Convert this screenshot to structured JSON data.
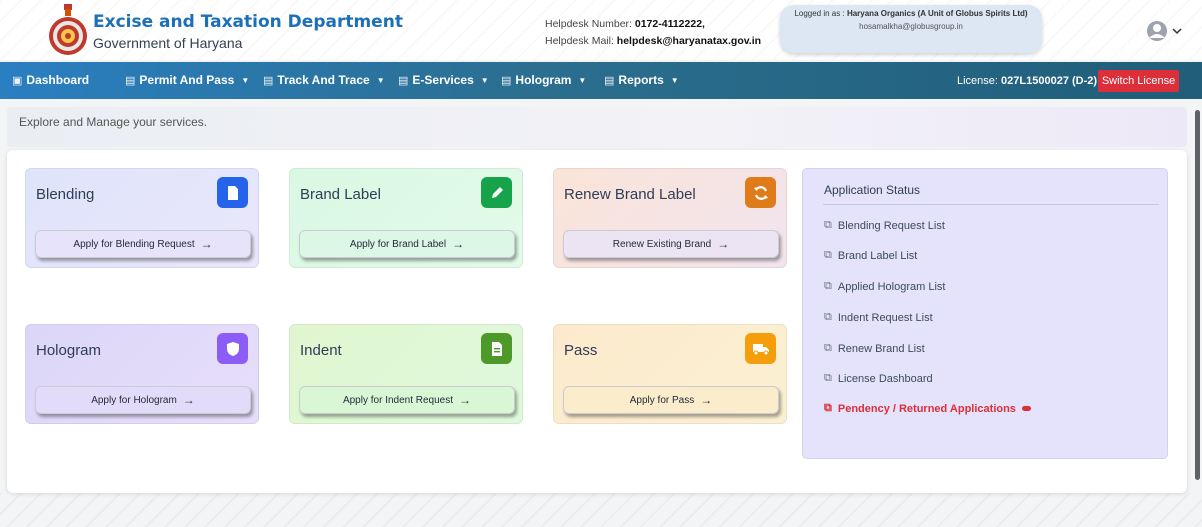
{
  "header": {
    "title": "Excise and Taxation Department",
    "subtitle": "Government of Haryana",
    "helpdesk_number_label": "Helpdesk Number:",
    "helpdesk_number": "0172-4112222,",
    "helpdesk_mail_label": "Helpdesk Mail:",
    "helpdesk_mail": "helpdesk@haryanatax.gov.in",
    "logged_in_label": "Logged in as :",
    "org_name": "Haryana Organics (A Unit of Globus Spirits Ltd)",
    "user_email": "hosamalkha@globusgroup.in"
  },
  "nav": {
    "items": [
      {
        "label": "Dashboard",
        "icon": "dashboard-icon"
      },
      {
        "label": "Permit And Pass",
        "icon": "list-icon"
      },
      {
        "label": "Track And Trace",
        "icon": "list-icon"
      },
      {
        "label": "E-Services",
        "icon": "list-icon"
      },
      {
        "label": "Hologram",
        "icon": "list-icon"
      },
      {
        "label": "Reports",
        "icon": "list-icon"
      }
    ],
    "license_label": "License:",
    "license_value": "027L1500027 (D-2)",
    "switch_label": "Switch License"
  },
  "explore_text": "Explore and Manage your services.",
  "cards": [
    {
      "title": "Blending",
      "button": "Apply for Blending Request",
      "icon": "document-icon",
      "color": "#2563eb"
    },
    {
      "title": "Brand Label",
      "button": "Apply for Brand Label",
      "icon": "pencil-icon",
      "color": "#16a34a"
    },
    {
      "title": "Renew Brand Label",
      "button": "Renew Existing Brand",
      "icon": "refresh-icon",
      "color": "#e07b1a"
    },
    {
      "title": "Hologram",
      "button": "Apply for Hologram",
      "icon": "shield-icon",
      "color": "#8b5cf6"
    },
    {
      "title": "Indent",
      "button": "Apply for Indent Request",
      "icon": "document-icon",
      "color": "#4d9a2a"
    },
    {
      "title": "Pass",
      "button": "Apply for Pass",
      "icon": "truck-icon",
      "color": "#f59e0b"
    }
  ],
  "status": {
    "title": "Application Status",
    "links": [
      "Blending Request List",
      "Brand Label List",
      "Applied Hologram List",
      "Indent Request List",
      "Renew Brand List",
      "License Dashboard"
    ],
    "pendency": "Pendency / Returned Applications"
  }
}
